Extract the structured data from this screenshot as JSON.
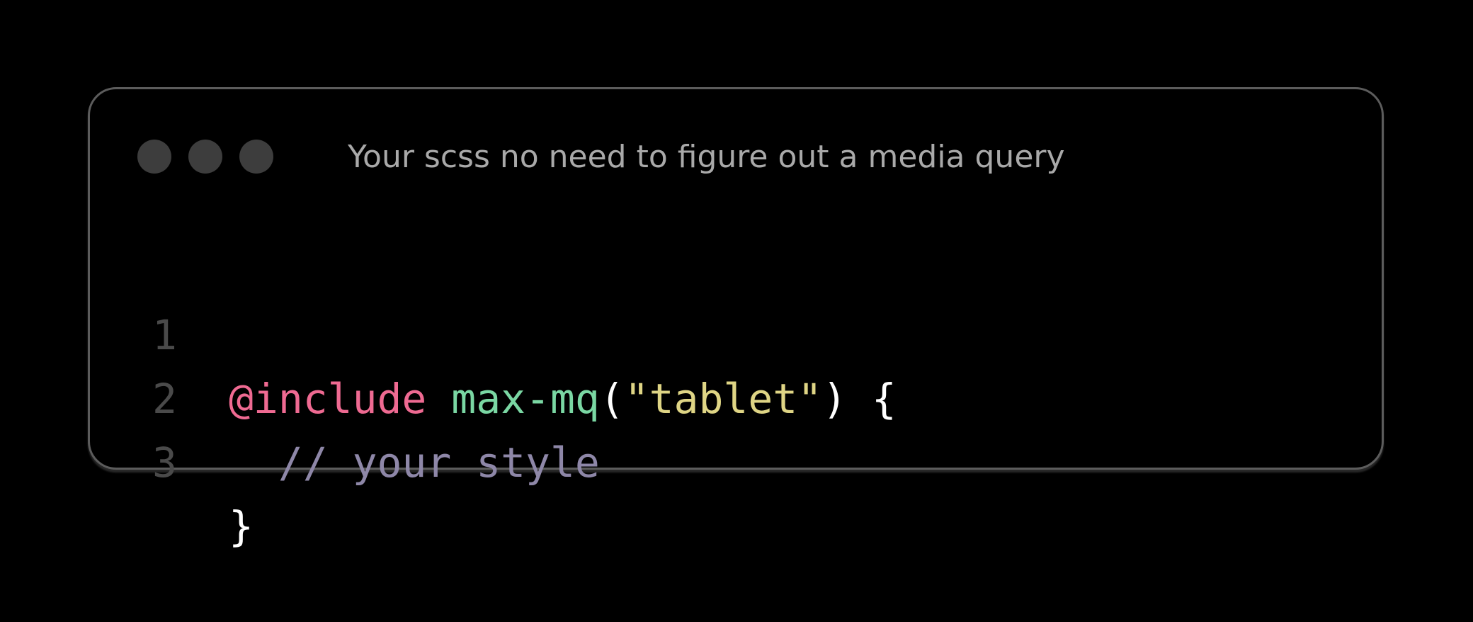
{
  "window": {
    "title": "Your scss no need to figure out a media query",
    "controls": [
      "window-dot",
      "window-dot",
      "window-dot"
    ]
  },
  "code": {
    "language": "scss",
    "lines": [
      {
        "number": "1",
        "tokens": [
          {
            "text": "@include",
            "kind": "keyword"
          },
          {
            "text": " ",
            "kind": "space"
          },
          {
            "text": "max-mq",
            "kind": "function"
          },
          {
            "text": "(",
            "kind": "punctuation"
          },
          {
            "text": "\"tablet\"",
            "kind": "string"
          },
          {
            "text": ") {",
            "kind": "punctuation"
          }
        ]
      },
      {
        "number": "2",
        "tokens": [
          {
            "text": "  ",
            "kind": "space"
          },
          {
            "text": "// your style",
            "kind": "comment"
          }
        ]
      },
      {
        "number": "3",
        "tokens": [
          {
            "text": "}",
            "kind": "punctuation"
          }
        ]
      }
    ]
  },
  "colors": {
    "background": "#000000",
    "keyword": "#ef6a92",
    "function": "#7ad7a3",
    "string": "#dfd585",
    "comment": "#8e87a8",
    "line_number": "#4a4a4a",
    "title": "#a9a9a9"
  }
}
